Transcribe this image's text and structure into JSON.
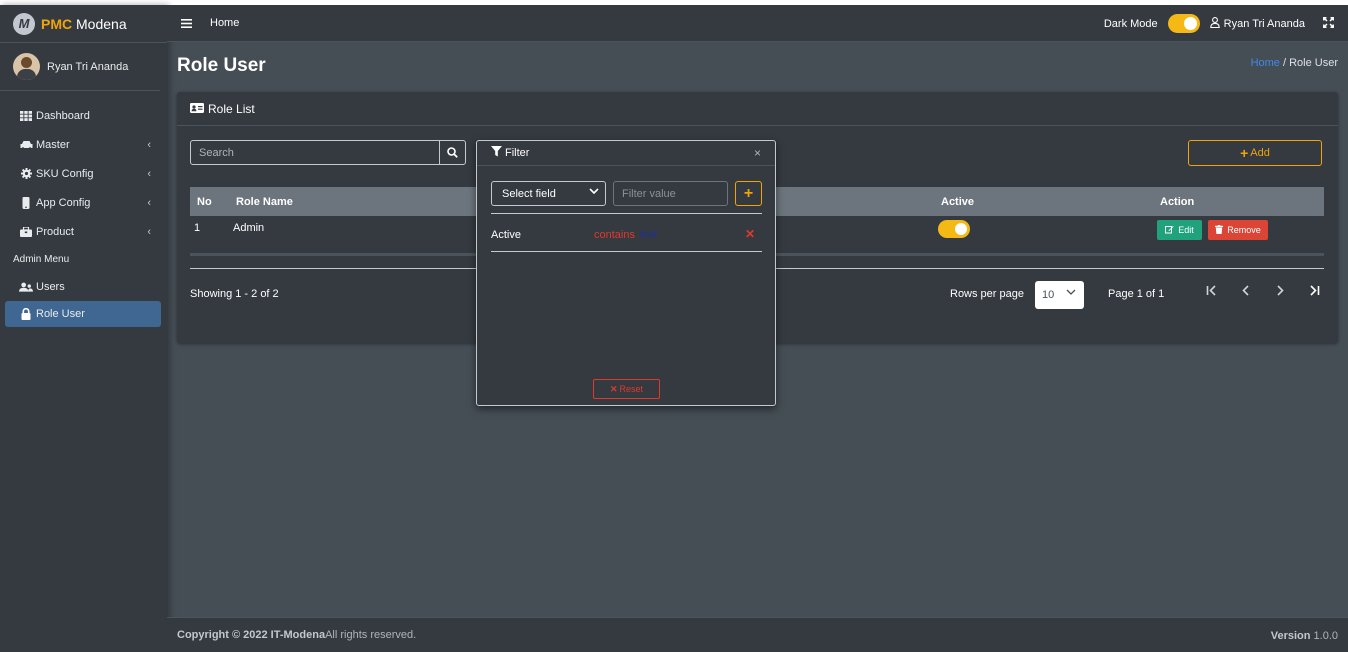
{
  "brand": {
    "logo_letter": "M",
    "pmc": "PMC",
    "name": "Modena"
  },
  "user": {
    "name": "Ryan Tri Ananda"
  },
  "sidebar": {
    "items": [
      {
        "label": "Dashboard",
        "icon": "grid-icon"
      },
      {
        "label": "Master",
        "icon": "car-icon",
        "chevron": "‹"
      },
      {
        "label": "SKU Config",
        "icon": "gear-icon",
        "chevron": "‹"
      },
      {
        "label": "App Config",
        "icon": "mobile-icon",
        "chevron": "‹"
      },
      {
        "label": "Product",
        "icon": "box-icon",
        "chevron": "‹"
      }
    ],
    "header": "Admin Menu",
    "admin_items": [
      {
        "label": "Users",
        "icon": "users-icon"
      },
      {
        "label": "Role User",
        "icon": "lock-icon",
        "active": true
      }
    ]
  },
  "topbar": {
    "home": "Home",
    "dark_mode_label": "Dark Mode",
    "user_name": "Ryan Tri Ananda"
  },
  "page": {
    "title": "Role User",
    "breadcrumb_home": "Home",
    "breadcrumb_sep": "/",
    "breadcrumb_current": "Role User"
  },
  "card": {
    "title": "Role List",
    "search_placeholder": "Search",
    "add_label": "Add",
    "columns": {
      "no": "No",
      "role_name": "Role Name",
      "active": "Active",
      "action": "Action"
    },
    "rows": [
      {
        "no": "1",
        "role_name": "Admin",
        "active": true,
        "edit": "Edit",
        "remove": "Remove"
      }
    ],
    "showing": "Showing 1 - 2 of 2",
    "rows_per_page_label": "Rows per page",
    "rows_per_page_value": "10",
    "page_info": "Page 1 of 1"
  },
  "filter": {
    "title": "Filter",
    "close": "×",
    "select_field": "Select field",
    "filter_value_placeholder": "Filter value",
    "add": "+",
    "rule": {
      "field": "Active",
      "operator": "contains",
      "value": "true",
      "remove": "✕"
    },
    "reset": "Reset"
  },
  "footer": {
    "copyright": "Copyright © 2022 IT-Modena",
    "rights": " All rights reserved.",
    "version_label": "Version",
    "version": " 1.0.0"
  },
  "colors": {
    "accent": "#f0a30a",
    "toggle": "#f5b915",
    "active_nav": "#3f6791",
    "edit": "#20a37c",
    "remove": "#dc4536"
  }
}
